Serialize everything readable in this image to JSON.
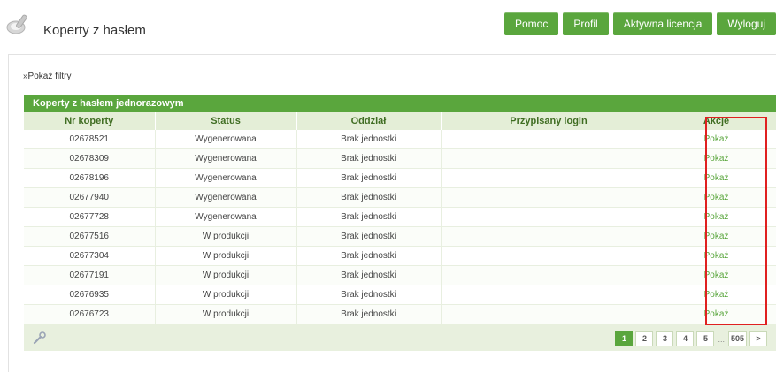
{
  "header": {
    "title": "Koperty z hasłem",
    "nav": [
      "Pomoc",
      "Profil",
      "Aktywna licencja",
      "Wyloguj"
    ]
  },
  "filters": {
    "label": "»Pokaż filtry"
  },
  "grid": {
    "title": "Koperty z hasłem jednorazowym",
    "columns": [
      "Nr koperty",
      "Status",
      "Oddział",
      "Przypisany login",
      "Akcje"
    ],
    "rows": [
      {
        "nr": "02678521",
        "status": "Wygenerowana",
        "oddzial": "Brak jednostki",
        "login": "",
        "action": "Pokaż"
      },
      {
        "nr": "02678309",
        "status": "Wygenerowana",
        "oddzial": "Brak jednostki",
        "login": "",
        "action": "Pokaż"
      },
      {
        "nr": "02678196",
        "status": "Wygenerowana",
        "oddzial": "Brak jednostki",
        "login": "",
        "action": "Pokaż"
      },
      {
        "nr": "02677940",
        "status": "Wygenerowana",
        "oddzial": "Brak jednostki",
        "login": "",
        "action": "Pokaż"
      },
      {
        "nr": "02677728",
        "status": "Wygenerowana",
        "oddzial": "Brak jednostki",
        "login": "",
        "action": "Pokaż"
      },
      {
        "nr": "02677516",
        "status": "W produkcji",
        "oddzial": "Brak jednostki",
        "login": "",
        "action": "Pokaż"
      },
      {
        "nr": "02677304",
        "status": "W produkcji",
        "oddzial": "Brak jednostki",
        "login": "",
        "action": "Pokaż"
      },
      {
        "nr": "02677191",
        "status": "W produkcji",
        "oddzial": "Brak jednostki",
        "login": "",
        "action": "Pokaż"
      },
      {
        "nr": "02676935",
        "status": "W produkcji",
        "oddzial": "Brak jednostki",
        "login": "",
        "action": "Pokaż"
      },
      {
        "nr": "02676723",
        "status": "W produkcji",
        "oddzial": "Brak jednostki",
        "login": "",
        "action": "Pokaż"
      }
    ]
  },
  "pager": {
    "pages": [
      "1",
      "2",
      "3",
      "4",
      "5"
    ],
    "active": "1",
    "ellipsis": "...",
    "last": "505",
    "next": ">"
  },
  "colors": {
    "accent": "#5aa63d",
    "highlight": "#e02020"
  }
}
